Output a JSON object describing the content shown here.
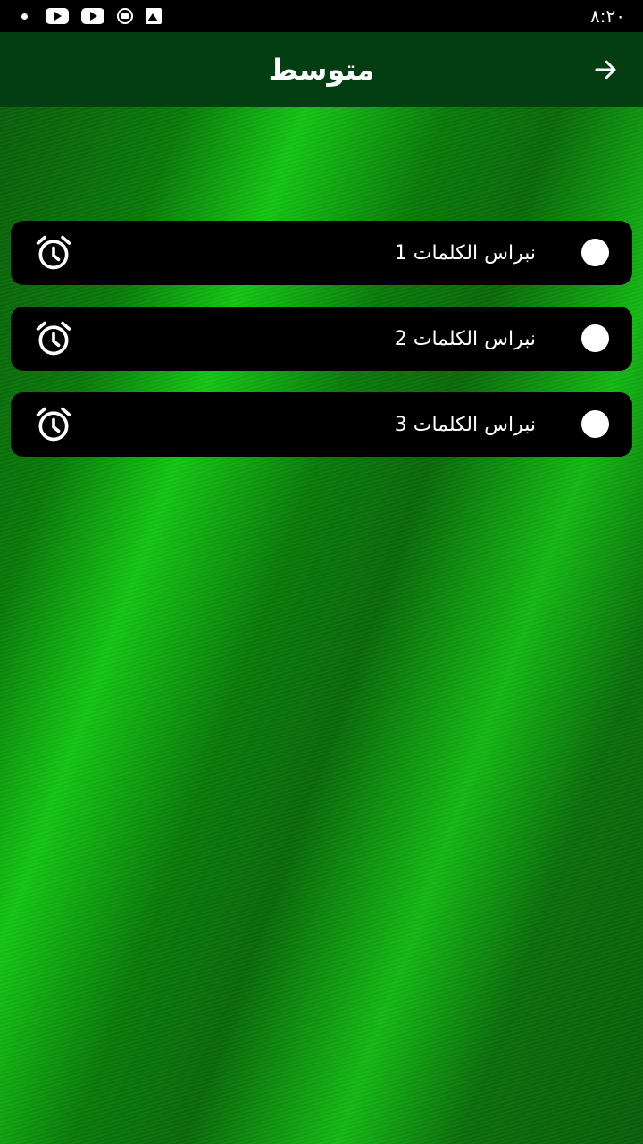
{
  "status_bar": {
    "time": "٨:٢٠",
    "icons": [
      "dot-icon",
      "youtube-icon",
      "youtube-icon",
      "cast-icon",
      "image-icon"
    ]
  },
  "app_bar": {
    "title": "متوسط",
    "back_icon": "arrow-right-icon"
  },
  "list": {
    "items": [
      {
        "label": "نبراس الكلمات 1",
        "icon": "alarm-clock-icon"
      },
      {
        "label": "نبراس الكلمات 2",
        "icon": "alarm-clock-icon"
      },
      {
        "label": "نبراس الكلمات 3",
        "icon": "alarm-clock-icon"
      }
    ]
  },
  "colors": {
    "app_bar_bg": "#033d12",
    "item_bg": "#000000",
    "background_green": "#14c514"
  }
}
